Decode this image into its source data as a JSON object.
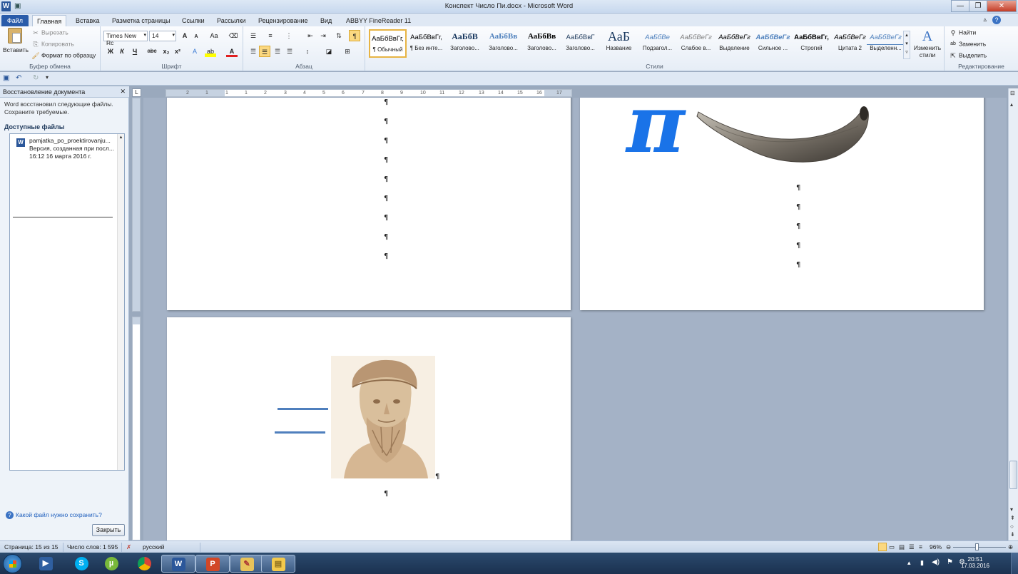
{
  "window": {
    "title": "Конспект Число Пи.docx - Microsoft Word",
    "app_icon": "W",
    "controls": [
      "—",
      "❐",
      "✕"
    ]
  },
  "tabs": {
    "file": "Файл",
    "items": [
      "Главная",
      "Вставка",
      "Разметка страницы",
      "Ссылки",
      "Рассылки",
      "Рецензирование",
      "Вид",
      "ABBYY FineReader 11"
    ],
    "active": "Главная"
  },
  "ribbon": {
    "clipboard": {
      "label": "Буфер обмена",
      "paste": "Вставить",
      "cut": "Вырезать",
      "copy": "Копировать",
      "format_painter": "Формат по образцу"
    },
    "font": {
      "label": "Шрифт",
      "font_name": "Times New Rc",
      "font_size": "14",
      "bold": "Ж",
      "italic": "К",
      "underline": "Ч",
      "strike": "abc",
      "subscript": "x₂",
      "superscript": "x²",
      "grow": "A",
      "shrink": "A",
      "case": "Aa",
      "color_letter": "A"
    },
    "paragraph": {
      "label": "Абзац",
      "pilcrow": "¶"
    },
    "styles": {
      "label": "Стили",
      "items": [
        {
          "sample": "АаБбВвГг,",
          "name": "¶ Обычный",
          "color": "#000000"
        },
        {
          "sample": "АаБбВвГг,",
          "name": "¶ Без инте...",
          "color": "#000000"
        },
        {
          "sample": "АаБбВ",
          "name": "Заголово...",
          "color": "#17365d"
        },
        {
          "sample": "АаБбВв",
          "name": "Заголово...",
          "color": "#4f81bd"
        },
        {
          "sample": "АаБбВв",
          "name": "Заголово...",
          "color": "#000000"
        },
        {
          "sample": "АаБбВвГ",
          "name": "Заголово...",
          "color": "#243f60"
        },
        {
          "sample": "АаБ",
          "name": "Название",
          "color": "#17365d"
        },
        {
          "sample": "АаБбВе",
          "name": "Подзагол...",
          "color": "#4f81bd"
        },
        {
          "sample": "АаБбВеГг",
          "name": "Слабое в...",
          "color": "#7f7f7f"
        },
        {
          "sample": "АаБбВеГг",
          "name": "Выделение",
          "color": "#000000"
        },
        {
          "sample": "АаБбВеГг",
          "name": "Сильное ...",
          "color": "#4f81bd"
        },
        {
          "sample": "АаБбВвГг,",
          "name": "Строгий",
          "color": "#000000"
        },
        {
          "sample": "АаБбВеГг",
          "name": "Цитата 2",
          "color": "#000000"
        },
        {
          "sample": "АаБбВеГг",
          "name": "Выделенн...",
          "color": "#4f81bd"
        }
      ],
      "change_styles": "Изменить стили"
    },
    "editing": {
      "label": "Редактирование",
      "find": "Найти",
      "replace": "Заменить",
      "select": "Выделить"
    }
  },
  "recovery_pane": {
    "title": "Восстановление документа",
    "description": "Word восстановил следующие файлы. Сохраните требуемые.",
    "available_header": "Доступные файлы",
    "file": {
      "name": "pamjatka_po_proektirovanju...",
      "version": "Версия, созданная при посл...",
      "date": "16:12 16 марта 2016 г."
    },
    "help_link": "Какой файл нужно сохранить?",
    "close_button": "Закрыть"
  },
  "ruler": {
    "numbers": [
      "2",
      "1",
      "1",
      "1",
      "2",
      "3",
      "4",
      "5",
      "6",
      "7",
      "8",
      "9",
      "10",
      "11",
      "12",
      "13",
      "14",
      "15",
      "16",
      "17"
    ]
  },
  "document": {
    "pilcrow": "¶",
    "pi_symbol": "π"
  },
  "status_bar": {
    "page": "Страница: 15 из 15",
    "words": "Число слов: 1 595",
    "language": "русский",
    "zoom": "96%",
    "zoom_fraction": 0.45
  },
  "taskbar": {
    "time": "20:51",
    "date": "17.03.2016",
    "apps": [
      "media-player",
      "skype",
      "utorrent",
      "chrome",
      "word",
      "powerpoint",
      "paint",
      "explorer"
    ]
  },
  "colors": {
    "accent": "#2b579a",
    "file_tab": "#2a5caa",
    "pi_blue": "#1a73e8",
    "line_blue": "#4f7fbd"
  }
}
